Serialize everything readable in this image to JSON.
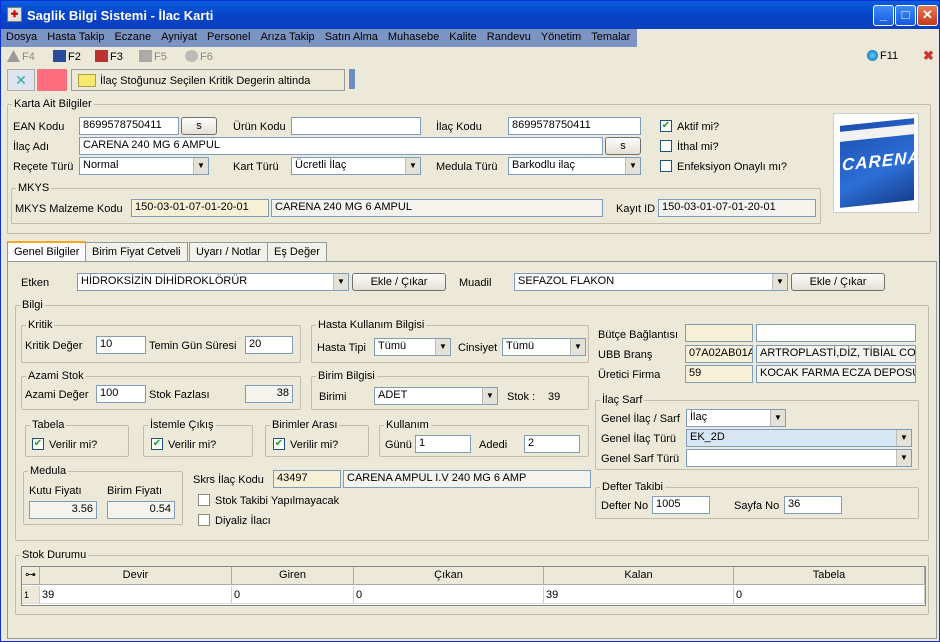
{
  "window": {
    "title": "Saglik Bilgi Sistemi - İlac Karti"
  },
  "menu": [
    "Dosya",
    "Hasta Takip",
    "Eczane",
    "Ayniyat",
    "Personel",
    "Arıza Takip",
    "Satın Alma",
    "Muhasebe",
    "Kalite",
    "Randevu",
    "Yönetim",
    "Temalar"
  ],
  "toolbar": {
    "f4": "F4",
    "f2": "F2",
    "f3": "F3",
    "f5": "F5",
    "f6": "F6",
    "f11": "F11"
  },
  "warning": {
    "text": "İlaç Stoğunuz Seçilen Kritik Degerin altinda"
  },
  "karta": {
    "legend": "Karta Ait Bilgiler",
    "ean_label": "EAN Kodu",
    "ean_value": "8699578750411",
    "s_btn": "s",
    "urun_label": "Ürün Kodu",
    "urun_value": "",
    "ilac_kodu_label": "İlaç Kodu",
    "ilac_kodu_value": "8699578750411",
    "aktif_label": "Aktif mi?",
    "ithal_label": "İthal mi?",
    "enf_label": "Enfeksiyon Onaylı mı?",
    "ilac_adi_label": "İlaç Adı",
    "ilac_adi_value": "CARENA 240 MG  6 AMPUL",
    "s2_btn": "s",
    "recete_label": "Reçete Türü",
    "recete_value": "Normal",
    "kart_label": "Kart Türü",
    "kart_value": "Ücretli İlaç",
    "medula_label": "Medula Türü",
    "medula_value": "Barkodlu ilaç"
  },
  "mkys": {
    "legend": "MKYS",
    "kod_label": "MKYS Malzeme Kodu",
    "kod_value": "150-03-01-07-01-20-01",
    "ad_value": "CARENA 240 MG  6 AMPUL",
    "kayit_label": "Kayıt ID",
    "kayit_value": "150-03-01-07-01-20-01"
  },
  "product_image": {
    "brand": "CARENA"
  },
  "tabs": [
    "Genel Bilgiler",
    "Birim Fiyat Cetveli",
    "Uyarı / Notlar",
    "Eş Değer"
  ],
  "etken": {
    "label": "Etken",
    "value": "HİDROKSİZİN DİHİDROKLÖRÜR",
    "btn": "Ekle / Çıkar",
    "muadil_label": "Muadil",
    "muadil_value": "SEFAZOL FLAKON",
    "btn2": "Ekle / Çıkar"
  },
  "bilgi": {
    "legend": "Bilgi"
  },
  "kritik": {
    "legend": "Kritik",
    "deger_label": "Kritik Değer",
    "deger_value": "10",
    "temin_label": "Temin Gün Süresi",
    "temin_value": "20"
  },
  "azami": {
    "legend": "Azami Stok",
    "deger_label": "Azami Değer",
    "deger_value": "100",
    "fazla_label": "Stok Fazlası",
    "fazla_value": "38"
  },
  "hasta": {
    "legend": "Hasta Kullanım Bilgisi",
    "tipi_label": "Hasta Tipi",
    "tipi_value": "Tümü",
    "cins_label": "Cinsiyet",
    "cins_value": "Tümü"
  },
  "birim": {
    "legend": "Birim Bilgisi",
    "label": "Birimi",
    "value": "ADET",
    "stok_label": "Stok :",
    "stok_value": "39"
  },
  "tabela": {
    "legend": "Tabela",
    "chk": "Verilir mi?"
  },
  "istemle": {
    "legend": "İstemle Çıkış",
    "chk": "Verilir mi?"
  },
  "birimler": {
    "legend": "Birimler Arası",
    "chk": "Verilir mi?"
  },
  "kullanim": {
    "legend": "Kullanım",
    "gunu_label": "Günü",
    "gunu_value": "1",
    "adedi_label": "Adedi",
    "adedi_value": "2"
  },
  "medula": {
    "legend": "Medula",
    "kutu_label": "Kutu Fiyatı",
    "kutu_value": "3.56",
    "birim_label": "Birim Fiyatı",
    "birim_value": "0.54"
  },
  "skrs": {
    "label": "Skrs İlaç Kodu",
    "kod": "43497",
    "ad": "CARENA AMPUL I.V 240 MG 6 AMP",
    "stok_takibi": "Stok Takibi Yapılmayacak",
    "diyaliz": "Diyaliz İlacı"
  },
  "right": {
    "butce_label": "Bütçe Bağlantısı",
    "butce_a": "",
    "butce_b": "",
    "ubb_label": "UBB Branş",
    "ubb_code": "07A02AB01A",
    "ubb_name": "ARTROPLASTİ,DİZ, TİBİAL COM",
    "uretici_label": "Üretici Firma",
    "uretici_code": "59",
    "uretici_name": "KOCAK FARMA ECZA DEPOSU"
  },
  "sarf": {
    "legend": "İlaç Sarf",
    "g1_label": "Genel İlaç / Sarf",
    "g1_value": "İlaç",
    "g2_label": "Genel İlaç Türü",
    "g2_value": "EK_2D",
    "g3_label": "Genel Sarf Türü",
    "g3_value": ""
  },
  "defter": {
    "legend": "Defter Takibi",
    "no_label": "Defter No",
    "no_value": "1005",
    "sayfa_label": "Sayfa No",
    "sayfa_value": "36"
  },
  "stok": {
    "legend": "Stok Durumu",
    "columns": [
      "Devir",
      "Giren",
      "Çıkan",
      "Kalan",
      "Tabela"
    ],
    "row_num": "1",
    "row": [
      "39",
      "0",
      "0",
      "39",
      "0"
    ]
  }
}
